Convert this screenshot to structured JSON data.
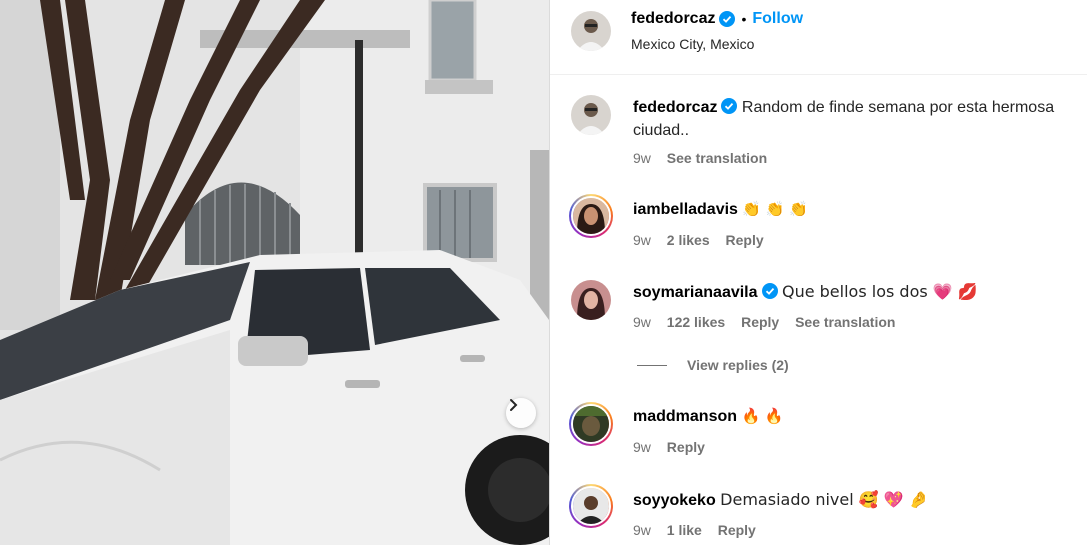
{
  "post": {
    "author": "fededorcaz",
    "follow_label": "Follow",
    "separator": "•",
    "location": "Mexico City, Mexico"
  },
  "caption": {
    "username": "fededorcaz",
    "text": "Random de finde semana por esta hermosa ciudad..",
    "time": "9w",
    "see_translation": "See translation"
  },
  "comments": [
    {
      "username": "iambelladavis",
      "text": "👏 👏 👏",
      "time": "9w",
      "likes": "2 likes",
      "reply": "Reply"
    },
    {
      "username": "soymarianaavila",
      "text": "Que bellos los dos 💗 💋",
      "time": "9w",
      "likes": "122 likes",
      "reply": "Reply",
      "see_translation": "See translation"
    },
    {
      "username": "maddmanson",
      "text": "🔥 🔥",
      "time": "9w",
      "reply": "Reply"
    },
    {
      "username": "soyyokeko",
      "text": "Demasiado nivel 🥰 💖 🤌",
      "time": "9w",
      "likes": "1 like",
      "reply": "Reply"
    }
  ],
  "view_replies": "View replies (2)",
  "colors": {
    "accent": "#0095f6",
    "verified": "#0095f6",
    "muted": "#737373"
  }
}
